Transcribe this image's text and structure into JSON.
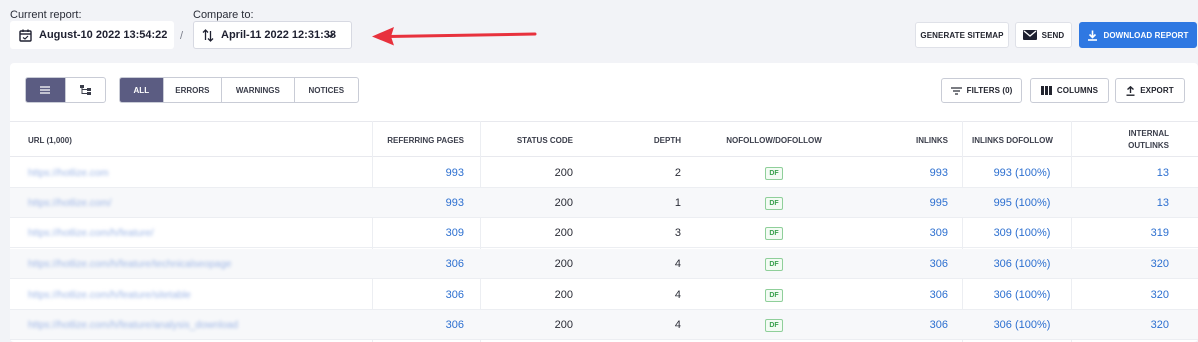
{
  "header": {
    "current_label": "Current report:",
    "current_value": "August-10 2022 13:54:22",
    "separator": "/",
    "compare_label": "Compare to:",
    "compare_value": "April-11 2022 12:31:38",
    "generate_sitemap": "GENERATE SITEMAP",
    "send": "SEND",
    "download": "DOWNLOAD REPORT"
  },
  "toolbar": {
    "filters_all": "ALL",
    "filters_errors": "ERRORS",
    "filters_warnings": "WARNINGS",
    "filters_notices": "NOTICES",
    "filters_btn": "FILTERS (0)",
    "columns_btn": "COLUMNS",
    "export_btn": "EXPORT"
  },
  "table": {
    "columns": {
      "url": "URL (1,000)",
      "referring": "REFERRING PAGES",
      "status": "STATUS CODE",
      "depth": "DEPTH",
      "nofollow": "NOFOLLOW/DOFOLLOW",
      "inlinks": "INLINKS",
      "inlinks_dofollow": "INLINKS DOFOLLOW",
      "internal_outlinks": "INTERNAL OUTLINKS"
    },
    "rows": [
      {
        "url": "https://hotlize.com",
        "referring": "993",
        "status": "200",
        "depth": "2",
        "follow": "DF",
        "inlinks": "993",
        "dofollow": "993 (100%)",
        "outlinks": "13"
      },
      {
        "url": "https://hotlize.com/",
        "referring": "993",
        "status": "200",
        "depth": "1",
        "follow": "DF",
        "inlinks": "995",
        "dofollow": "995 (100%)",
        "outlinks": "13"
      },
      {
        "url": "https://hotlize.com/h/feature/",
        "referring": "309",
        "status": "200",
        "depth": "3",
        "follow": "DF",
        "inlinks": "309",
        "dofollow": "309 (100%)",
        "outlinks": "319"
      },
      {
        "url": "https://hotlize.com/h/feature/technicalseopage",
        "referring": "306",
        "status": "200",
        "depth": "4",
        "follow": "DF",
        "inlinks": "306",
        "dofollow": "306 (100%)",
        "outlinks": "320"
      },
      {
        "url": "https://hotlize.com/h/feature/sitetable",
        "referring": "306",
        "status": "200",
        "depth": "4",
        "follow": "DF",
        "inlinks": "306",
        "dofollow": "306 (100%)",
        "outlinks": "320"
      },
      {
        "url": "https://hotlize.com/h/feature/analysis_download",
        "referring": "306",
        "status": "200",
        "depth": "4",
        "follow": "DF",
        "inlinks": "306",
        "dofollow": "306 (100%)",
        "outlinks": "320"
      }
    ]
  },
  "colors": {
    "accent": "#2f78e2",
    "segment_active": "#5b5c82",
    "arrow": "#e8313d",
    "link": "#2c6fd0"
  }
}
